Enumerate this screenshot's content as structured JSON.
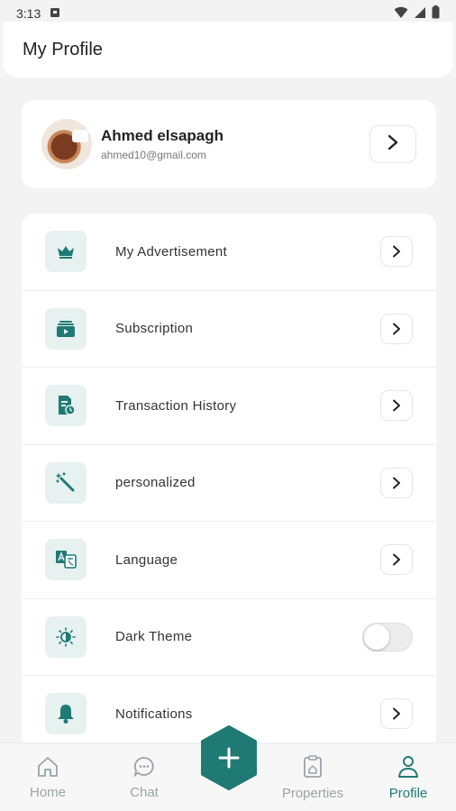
{
  "status_bar": {
    "time": "3:13"
  },
  "header": {
    "title": "My Profile"
  },
  "profile": {
    "name": "Ahmed elsapagh",
    "email": "ahmed10@gmail.com"
  },
  "menu": [
    {
      "label": "My Advertisement",
      "icon": "crown-icon"
    },
    {
      "label": "Subscription",
      "icon": "subscription-icon"
    },
    {
      "label": "Transaction History",
      "icon": "transaction-history-icon"
    },
    {
      "label": "personalized",
      "icon": "magic-wand-icon"
    },
    {
      "label": "Language",
      "icon": "translate-icon"
    },
    {
      "label": "Dark Theme",
      "icon": "brightness-icon",
      "toggle_on": false
    },
    {
      "label": "Notifications",
      "icon": "bell-icon"
    }
  ],
  "nav": {
    "home": "Home",
    "chat": "Chat",
    "properties": "Properties",
    "profile": "Profile",
    "active": "profile"
  },
  "colors": {
    "accent": "#1f7a74",
    "icon_bg": "#e7f1f0",
    "background": "#f3f3f3"
  }
}
